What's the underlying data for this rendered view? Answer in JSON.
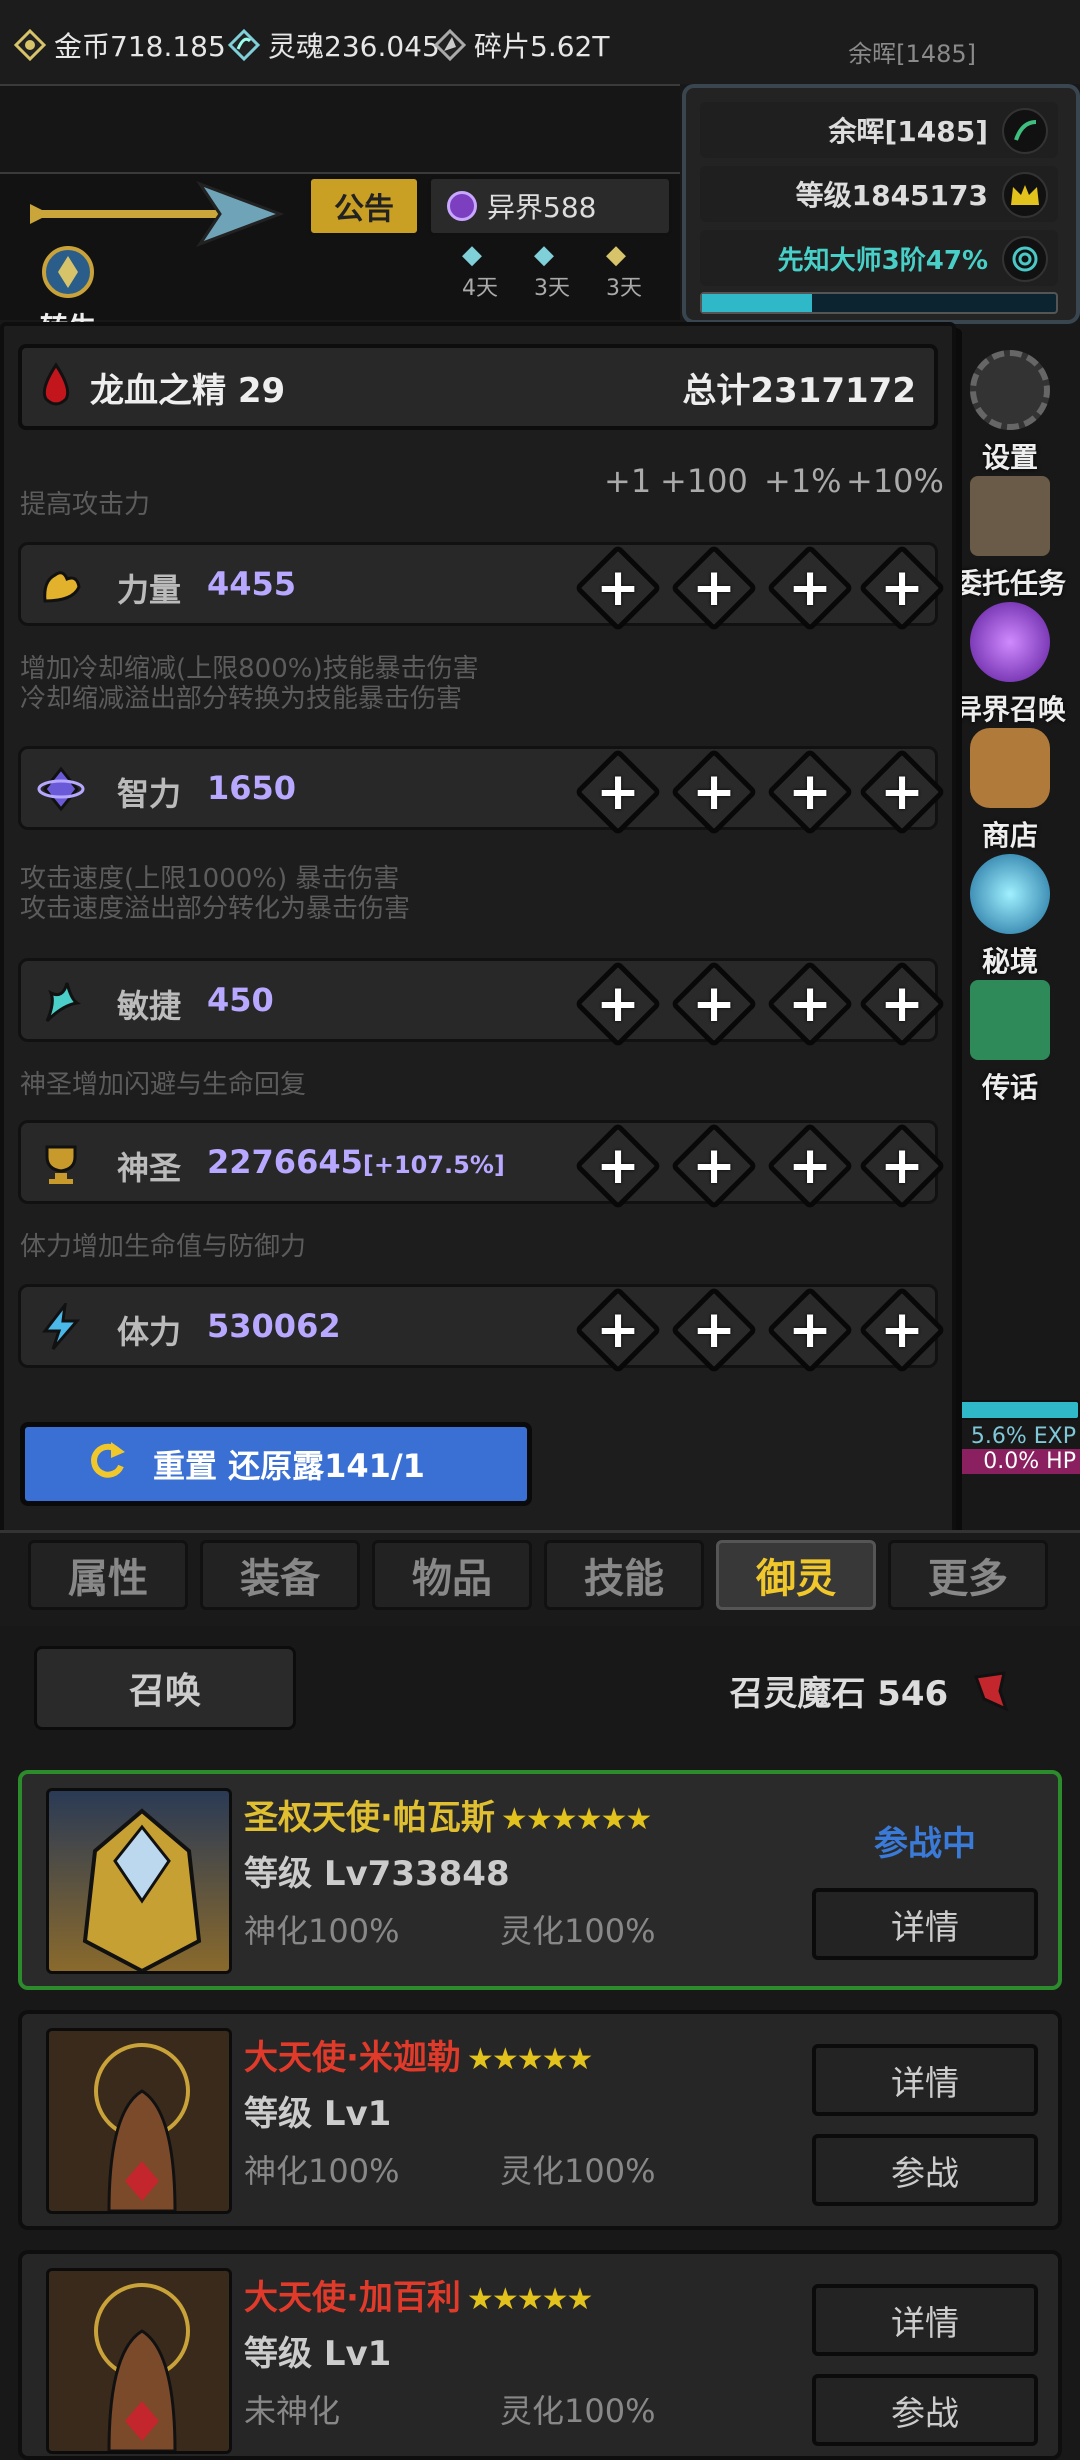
{
  "topbar": {
    "username": "余晖[1485]"
  },
  "resources": [
    {
      "icon": "gold-coin-icon",
      "label": "金币718.185"
    },
    {
      "icon": "soul-icon",
      "label": "灵魂236.045"
    },
    {
      "icon": "shard-icon",
      "label": "碎片5.62T"
    }
  ],
  "header_buttons": {
    "notice": "公告",
    "otherworld": "异界588",
    "rebirth": "转生"
  },
  "timers": [
    "4天",
    "3天",
    "3天"
  ],
  "profile": {
    "name": "余晖[1485]",
    "level": "等级1845173",
    "title": "先知大师3阶47%",
    "xp_progress": 0.31
  },
  "right_menu": [
    "设置",
    "委托任务",
    "异界召唤",
    "商店",
    "秘境",
    "传话"
  ],
  "right_stats": {
    "exp": "5.6% EXP",
    "hp": "0.0% HP"
  },
  "essence": {
    "name": "龙血之精 29",
    "total": "总计2317172"
  },
  "increments": [
    "+1",
    "+100",
    "+1%",
    "+10%"
  ],
  "attack_hint": "提高攻击力",
  "stats": [
    {
      "name": "力量",
      "value": "4455",
      "bonus": "",
      "desc_after": [
        "增加冷却缩减(上限800%)技能暴击伤害",
        "冷却缩减溢出部分转换为技能暴击伤害"
      ]
    },
    {
      "name": "智力",
      "value": "1650",
      "bonus": "",
      "desc_after": [
        "攻击速度(上限1000%) 暴击伤害",
        "攻击速度溢出部分转化为暴击伤害"
      ]
    },
    {
      "name": "敏捷",
      "value": "450",
      "bonus": "",
      "desc_after": [
        "神圣增加闪避与生命回复"
      ]
    },
    {
      "name": "神圣",
      "value": "2276645",
      "bonus": "[+107.5%]",
      "desc_after": [
        "体力增加生命值与防御力"
      ]
    },
    {
      "name": "体力",
      "value": "530062",
      "bonus": "",
      "desc_after": []
    }
  ],
  "reset_button": "重置 还原露141/1",
  "tabs": [
    "属性",
    "装备",
    "物品",
    "技能",
    "御灵",
    "更多"
  ],
  "active_tab": 4,
  "summon_button": "召唤",
  "summon_stones": "召灵魔石 546",
  "spirits": [
    {
      "name": "圣权天使·帕瓦斯",
      "name_color": "#e0c030",
      "stars": "★★★★★★",
      "level": "等级 Lv733848",
      "divine": "神化100%",
      "spirit": "灵化100%",
      "status": "参战中",
      "buttons": [
        "详情"
      ]
    },
    {
      "name": "大天使·米迦勒",
      "name_color": "#e03a2a",
      "stars": "★★★★★",
      "level": "等级 Lv1",
      "divine": "神化100%",
      "spirit": "灵化100%",
      "status": "",
      "buttons": [
        "详情",
        "参战"
      ]
    },
    {
      "name": "大天使·加百利",
      "name_color": "#e03a2a",
      "stars": "★★★★★",
      "level": "等级 Lv1",
      "divine": "未神化",
      "spirit": "灵化100%",
      "status": "",
      "buttons": [
        "详情",
        "参战"
      ]
    }
  ]
}
